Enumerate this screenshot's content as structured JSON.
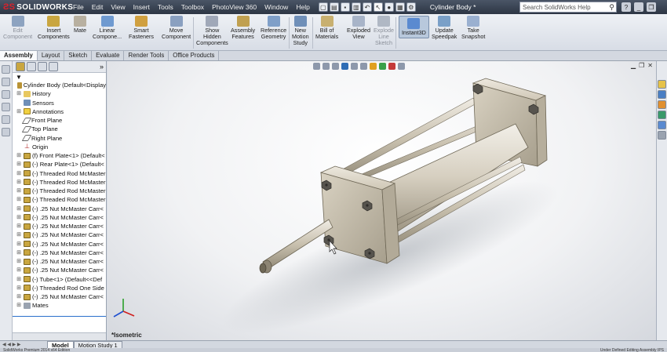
{
  "app": {
    "logo_text": "SOLIDWORKS",
    "document_title": "Cylinder Body *"
  },
  "menu": [
    {
      "label": "File"
    },
    {
      "label": "Edit"
    },
    {
      "label": "View"
    },
    {
      "label": "Insert"
    },
    {
      "label": "Tools"
    },
    {
      "label": "Toolbox"
    },
    {
      "label": "PhotoView 360"
    },
    {
      "label": "Window"
    },
    {
      "label": "Help"
    }
  ],
  "search": {
    "placeholder": "Search SolidWorks Help",
    "icon": "search-icon"
  },
  "ribbon": [
    {
      "label": "Edit\nComponent",
      "icon": "edit-component-icon",
      "dim": true
    },
    {
      "label": "Insert\nComponents",
      "icon": "insert-components-icon"
    },
    {
      "label": "Mate",
      "icon": "mate-icon"
    },
    {
      "label": "Linear\nCompone...",
      "icon": "linear-pattern-icon"
    },
    {
      "label": "Smart\nFasteners",
      "icon": "smart-fasteners-icon"
    },
    {
      "label": "Move\nComponent",
      "icon": "move-component-icon"
    },
    {
      "label": "Show\nHidden\nComponents",
      "icon": "show-hidden-icon"
    },
    {
      "label": "Assembly\nFeatures",
      "icon": "assembly-features-icon"
    },
    {
      "label": "Reference\nGeometry",
      "icon": "reference-geometry-icon"
    },
    {
      "label": "New\nMotion\nStudy",
      "icon": "motion-study-icon"
    },
    {
      "label": "Bill of\nMaterials",
      "icon": "bom-icon"
    },
    {
      "label": "Exploded\nView",
      "icon": "exploded-view-icon"
    },
    {
      "label": "Explode\nLine\nSketch",
      "icon": "explode-line-icon",
      "dim": true
    },
    {
      "label": "Instant3D",
      "icon": "instant3d-icon",
      "active": true
    },
    {
      "label": "Update\nSpeedpak",
      "icon": "speedpak-icon"
    },
    {
      "label": "Take\nSnapshot",
      "icon": "snapshot-icon"
    }
  ],
  "tabs": [
    {
      "label": "Assembly",
      "active": true
    },
    {
      "label": "Layout"
    },
    {
      "label": "Sketch"
    },
    {
      "label": "Evaluate"
    },
    {
      "label": "Render Tools"
    },
    {
      "label": "Office Products"
    }
  ],
  "tree": {
    "root": "Cylinder Body  (Default<Display",
    "items": [
      {
        "label": "History",
        "icon": "folder"
      },
      {
        "label": "Sensors",
        "icon": "sensor"
      },
      {
        "label": "Annotations",
        "icon": "annot"
      },
      {
        "label": "Front Plane",
        "icon": "plane"
      },
      {
        "label": "Top Plane",
        "icon": "plane"
      },
      {
        "label": "Right Plane",
        "icon": "plane"
      },
      {
        "label": "Origin",
        "icon": "origin"
      },
      {
        "label": "(f) Front Plate<1> (Default<",
        "icon": "part"
      },
      {
        "label": "(-) Rear Plate<1> (Default<",
        "icon": "part"
      },
      {
        "label": "(-) Threaded Rod McMaster",
        "icon": "part"
      },
      {
        "label": "(-) Threaded Rod McMaster",
        "icon": "part"
      },
      {
        "label": "(-) Threaded Rod McMaster",
        "icon": "part"
      },
      {
        "label": "(-) Threaded Rod McMaster",
        "icon": "part"
      },
      {
        "label": "(-) .25 Nut McMaster Carr<",
        "icon": "part"
      },
      {
        "label": "(-) .25 Nut McMaster Carr<",
        "icon": "part"
      },
      {
        "label": "(-) .25 Nut McMaster Carr<",
        "icon": "part"
      },
      {
        "label": "(-) .25 Nut McMaster Carr<",
        "icon": "part"
      },
      {
        "label": "(-) .25 Nut McMaster Carr<",
        "icon": "part"
      },
      {
        "label": "(-) .25 Nut McMaster Carr<",
        "icon": "part"
      },
      {
        "label": "(-) .25 Nut McMaster Carr<",
        "icon": "part"
      },
      {
        "label": "(-) .25 Nut McMaster Carr<",
        "icon": "part"
      },
      {
        "label": "(-) Tube<1> (Default<<Def",
        "icon": "part"
      },
      {
        "label": "(-) Threaded Rod One Side",
        "icon": "part"
      },
      {
        "label": "(-) .25 Nut McMaster Carr<",
        "icon": "part"
      },
      {
        "label": "Mates",
        "icon": "mates"
      }
    ]
  },
  "viewport": {
    "view_label": "*Isometric"
  },
  "bottom_tabs": [
    {
      "label": "Model",
      "active": true
    },
    {
      "label": "Motion Study 1"
    }
  ],
  "status": {
    "left": "SolidWorks Premium 2014 x64 Edition",
    "right": "Under Defined  Editing Assembly  IPS"
  },
  "colors": {
    "titlebar": "#2d3644",
    "accent": "#2a6fcc",
    "model_steel": "#c9c2b2",
    "logo_red": "#e0202a"
  }
}
